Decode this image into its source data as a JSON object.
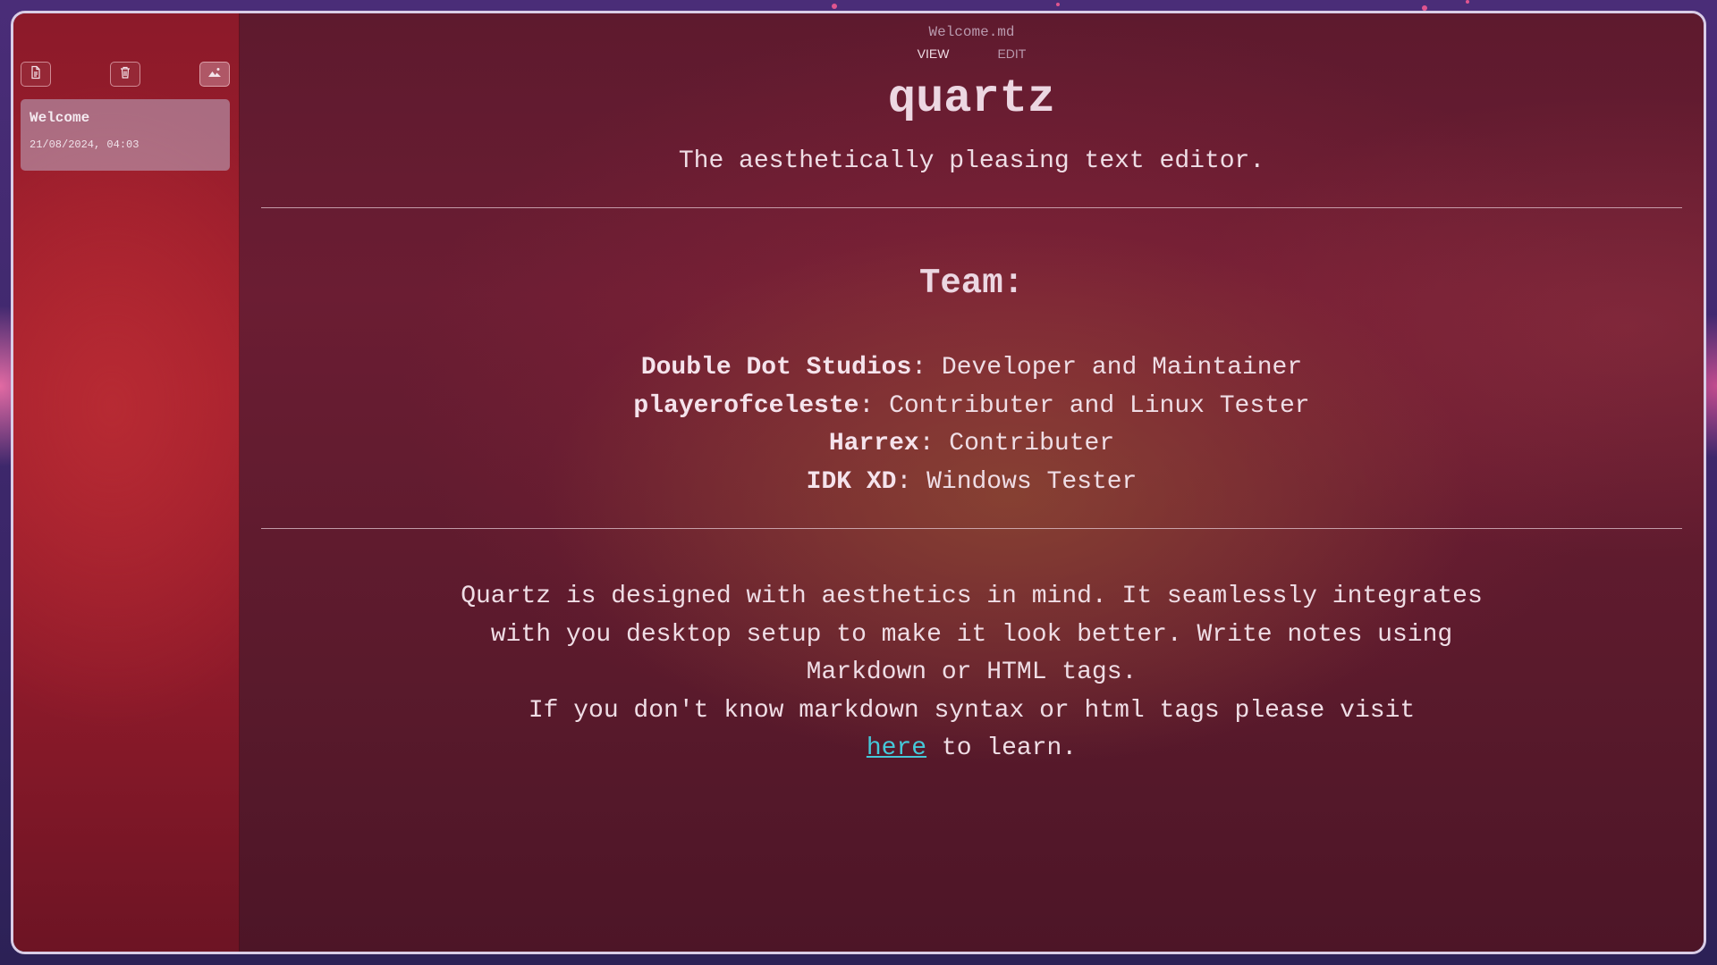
{
  "window": {
    "filename": "Welcome.md"
  },
  "toolbar": {
    "new_note_icon": "file-icon",
    "delete_icon": "trash-icon",
    "background_icon": "image-icon"
  },
  "sidebar": {
    "notes": [
      {
        "title": "Welcome",
        "date": "21/08/2024, 04:03"
      }
    ]
  },
  "tabs": {
    "view": "VIEW",
    "edit": "EDIT"
  },
  "document": {
    "title": "quartz",
    "subtitle": "The aesthetically pleasing text editor.",
    "team_heading": "Team:",
    "team": [
      {
        "name": "Double Dot Studios",
        "role": ": Developer and Maintainer"
      },
      {
        "name": "playerofceleste",
        "role": ": Contributer and Linux Tester"
      },
      {
        "name": "Harrex",
        "role": ": Contributer"
      },
      {
        "name": "IDK XD",
        "role": ": Windows Tester"
      }
    ],
    "paragraph_lines": [
      "Quartz is designed with aesthetics in mind. It seamlessly integrates",
      "with you desktop setup to make it look better. Write notes using",
      "Markdown or HTML tags.",
      "If you don't know markdown syntax or html tags please visit"
    ],
    "link_text": "here",
    "link_suffix": " to learn."
  },
  "colors": {
    "link": "#45c8d9",
    "window_border": "#d9cde6"
  }
}
